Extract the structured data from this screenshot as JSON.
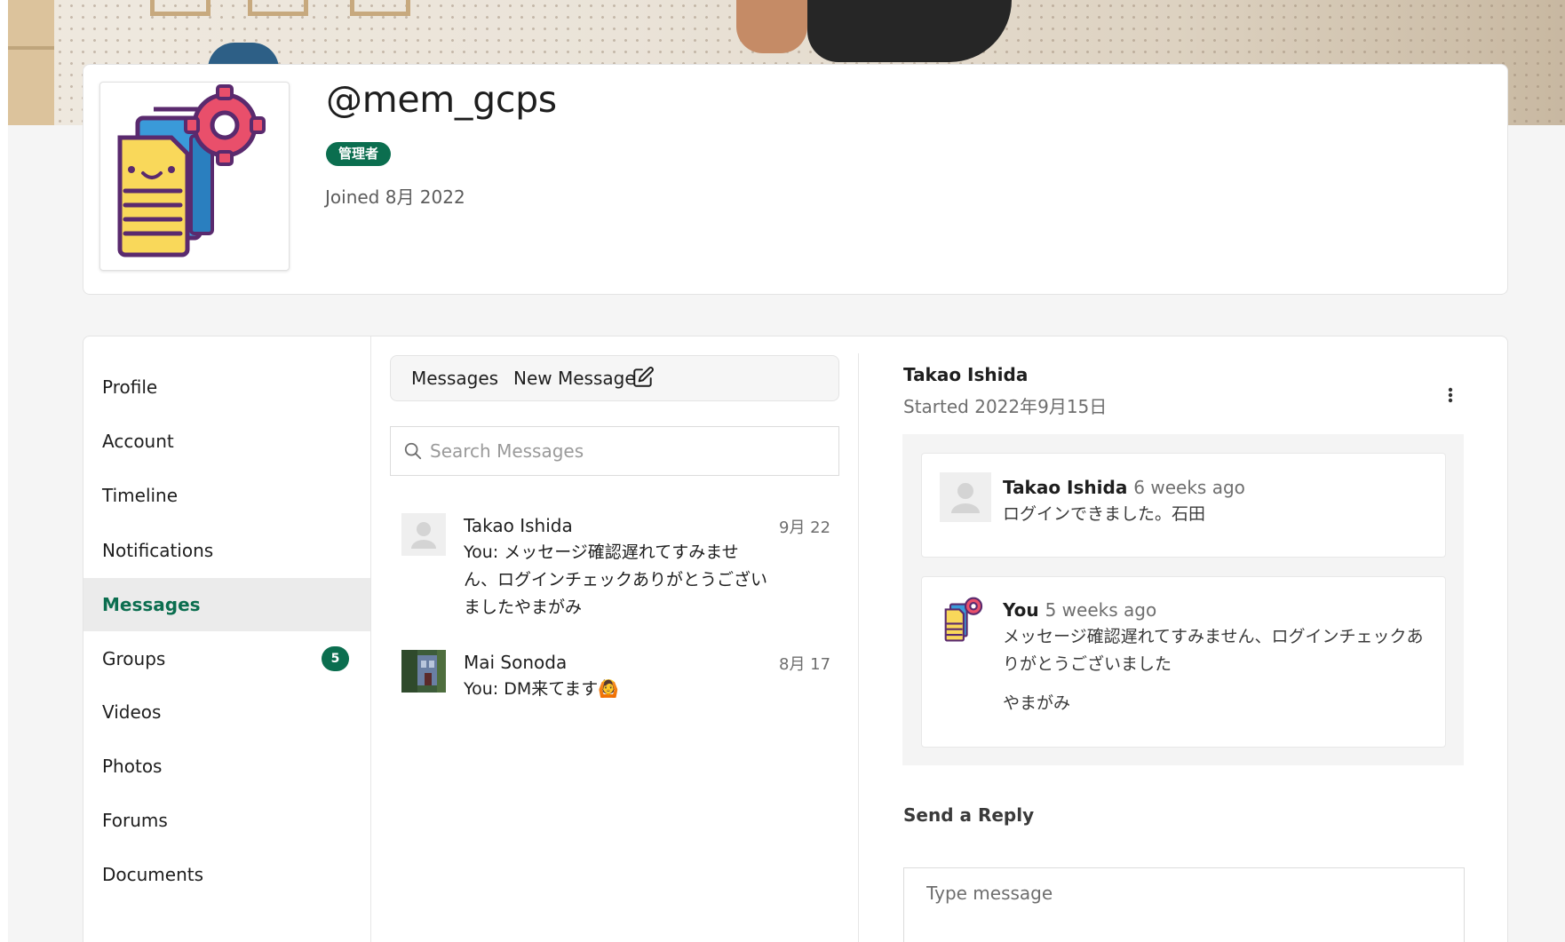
{
  "profile": {
    "username": "@mem_gcps",
    "role_badge": "管理者",
    "joined": "Joined 8月 2022"
  },
  "nav": {
    "items": [
      {
        "label": "Profile"
      },
      {
        "label": "Account"
      },
      {
        "label": "Timeline"
      },
      {
        "label": "Notifications"
      },
      {
        "label": "Messages",
        "active": true
      },
      {
        "label": "Groups",
        "count": "5"
      },
      {
        "label": "Videos"
      },
      {
        "label": "Photos"
      },
      {
        "label": "Forums"
      },
      {
        "label": "Documents"
      }
    ]
  },
  "messages": {
    "tab_messages": "Messages",
    "tab_new_message": "New Message",
    "search_placeholder": "Search Messages",
    "threads": [
      {
        "name": "Takao Ishida",
        "date": "9月 22",
        "preview": "You: メッセージ確認遅れてすみません、ログインチェックありがとうございましたやまがみ"
      },
      {
        "name": "Mai Sonoda",
        "date": "8月 17",
        "preview": "You: DM来てます🙆"
      }
    ]
  },
  "conversation": {
    "title": "Takao Ishida",
    "started": "Started 2022年9月15日",
    "messages": [
      {
        "author": "Takao Ishida",
        "time": "6 weeks ago",
        "text": "ログインできました。石田"
      },
      {
        "author": "You",
        "time": "5 weeks ago",
        "text": "メッセージ確認遅れてすみません、ログインチェックありがとうございました",
        "signature": "やまがみ"
      }
    ],
    "reply_label": "Send a Reply",
    "reply_placeholder": "Type message"
  },
  "colors": {
    "accent": "#0b6e4f",
    "active_nav_bg": "#ebebeb",
    "page_bg": "#f5f5f5"
  }
}
